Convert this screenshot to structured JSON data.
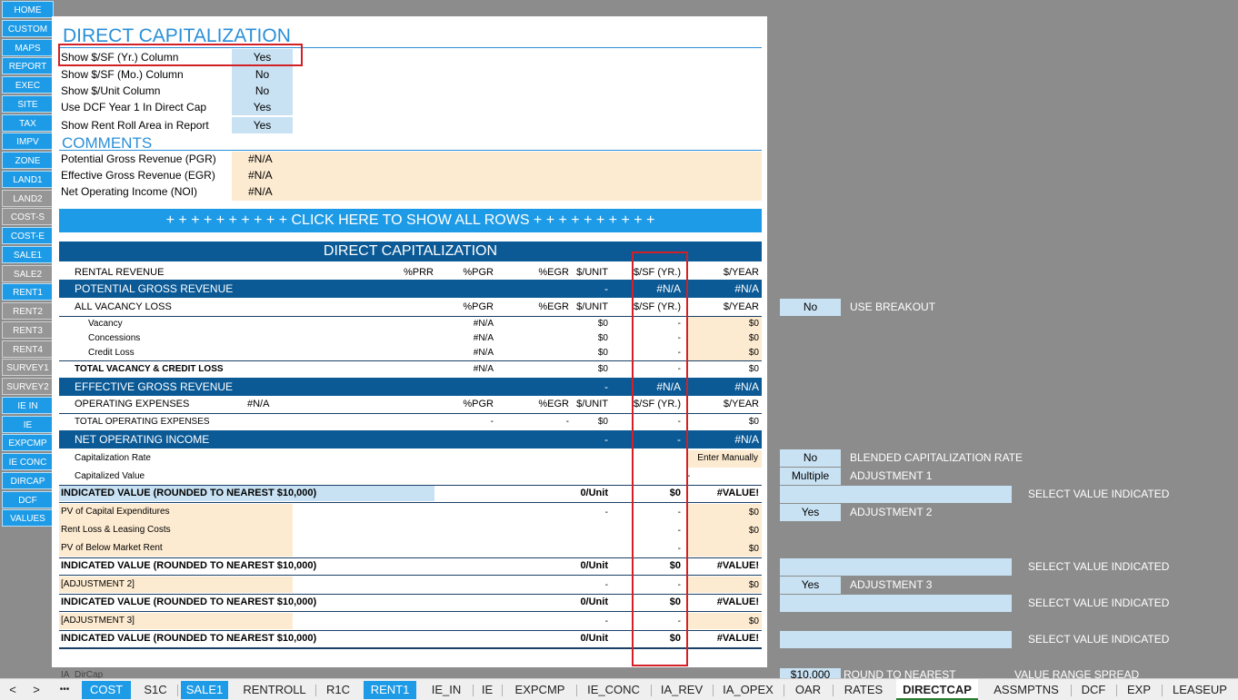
{
  "nav": [
    "HOME",
    "CUSTOM",
    "MAPS",
    "REPORT",
    "EXEC",
    "SITE",
    "TAX",
    "IMPV",
    "ZONE",
    "LAND1",
    "LAND2",
    "COST-S",
    "COST-E",
    "SALE1",
    "SALE2",
    "RENT1",
    "RENT2",
    "RENT3",
    "RENT4",
    "SURVEY1",
    "SURVEY2",
    "IE IN",
    "IE",
    "EXPCMP",
    "IE CONC",
    "DIRCAP",
    "DCF",
    "VALUES"
  ],
  "title": "DIRECT CAPITALIZATION",
  "settings": [
    {
      "label": "Show $/SF (Yr.) Column",
      "value": "Yes"
    },
    {
      "label": "Show $/SF (Mo.) Column",
      "value": "No"
    },
    {
      "label": "Show $/Unit Column",
      "value": "No"
    },
    {
      "label": "Use DCF Year 1 In Direct Cap",
      "value": "Yes"
    },
    {
      "label": "Show Rent Roll Area in Report",
      "value": "Yes"
    }
  ],
  "comments_title": "COMMENTS",
  "comments": [
    {
      "label": "Potential Gross Revenue (PGR)",
      "value": "#N/A"
    },
    {
      "label": "Effective Gross Revenue (EGR)",
      "value": "#N/A"
    },
    {
      "label": "Net Operating Income (NOI)",
      "value": "#N/A"
    }
  ],
  "show_all": "+ + + + + + + + + + CLICK HERE TO SHOW ALL ROWS + + + + + + + + + +",
  "table_title": "DIRECT CAPITALIZATION",
  "h_rental": {
    "label": "RENTAL REVENUE",
    "prr": "%PRR",
    "pgr": "%PGR",
    "egr": "%EGR",
    "unit": "$/UNIT",
    "sf": "$/SF (YR.)",
    "year": "$/YEAR"
  },
  "pgr_row": {
    "label": "POTENTIAL GROSS REVENUE",
    "unit": "-",
    "sf": "#N/A",
    "year": "#N/A"
  },
  "h_vacancy": {
    "label": "ALL VACANCY LOSS",
    "pgr": "%PGR",
    "egr": "%EGR",
    "unit": "$/UNIT",
    "sf": "$/SF (YR.)",
    "year": "$/YEAR"
  },
  "vac_rows": [
    {
      "label": "Vacancy",
      "pgr": "#N/A",
      "unit": "$0",
      "sf": "-",
      "year": "$0"
    },
    {
      "label": "Concessions",
      "pgr": "#N/A",
      "unit": "$0",
      "sf": "-",
      "year": "$0"
    },
    {
      "label": "Credit Loss",
      "pgr": "#N/A",
      "unit": "$0",
      "sf": "-",
      "year": "$0"
    }
  ],
  "total_vac": {
    "label": "TOTAL VACANCY & CREDIT LOSS",
    "pgr": "#N/A",
    "unit": "$0",
    "sf": "-",
    "year": "$0"
  },
  "egr_row": {
    "label": "EFFECTIVE GROSS REVENUE",
    "unit": "-",
    "sf": "#N/A",
    "year": "#N/A"
  },
  "h_opex": {
    "label": "OPERATING EXPENSES",
    "na": "#N/A",
    "pgr": "%PGR",
    "egr": "%EGR",
    "unit": "$/UNIT",
    "sf": "$/SF (YR.)",
    "year": "$/YEAR"
  },
  "total_opex": {
    "label": "TOTAL OPERATING EXPENSES",
    "pgr": "-",
    "egr": "-",
    "unit": "$0",
    "sf": "-",
    "year": "$0"
  },
  "noi_row": {
    "label": "NET OPERATING INCOME",
    "unit": "-",
    "sf": "-",
    "year": "#N/A"
  },
  "cap_rate": {
    "label": "Capitalization Rate",
    "year": "Enter Manually"
  },
  "cap_value": {
    "label": "Capitalized Value",
    "year": "-"
  },
  "ind1": {
    "label": "INDICATED VALUE (ROUNDED TO NEAREST $10,000)",
    "unit": "0/Unit",
    "sf": "$0",
    "year": "#VALUE!"
  },
  "adj_rows": [
    {
      "label": "PV of Capital Expenditures",
      "unit": "-",
      "sf": "-",
      "year": "$0"
    },
    {
      "label": "Rent Loss & Leasing Costs",
      "unit": "",
      "sf": "-",
      "year": "$0"
    },
    {
      "label": "PV of Below Market Rent",
      "unit": "",
      "sf": "-",
      "year": "$0"
    }
  ],
  "ind2": {
    "label": "INDICATED VALUE (ROUNDED TO NEAREST $10,000)",
    "unit": "0/Unit",
    "sf": "$0",
    "year": "#VALUE!"
  },
  "adj2": {
    "label": "[ADJUSTMENT 2]",
    "unit": "-",
    "sf": "-",
    "year": "$0"
  },
  "ind3": {
    "label": "INDICATED VALUE (ROUNDED TO NEAREST $10,000)",
    "unit": "0/Unit",
    "sf": "$0",
    "year": "#VALUE!"
  },
  "adj3": {
    "label": "[ADJUSTMENT 3]",
    "unit": "-",
    "sf": "-",
    "year": "$0"
  },
  "ind4": {
    "label": "INDICATED VALUE (ROUNDED TO NEAREST $10,000)",
    "unit": "0/Unit",
    "sf": "$0",
    "year": "#VALUE!"
  },
  "side": {
    "use_breakout": {
      "value": "No",
      "label": "USE BREAKOUT"
    },
    "blended": {
      "value": "No",
      "label": "BLENDED CAPITALIZATION RATE"
    },
    "adj1": {
      "value": "Multiple",
      "label": "ADJUSTMENT 1"
    },
    "select1": "SELECT VALUE INDICATED",
    "adj2": {
      "value": "Yes",
      "label": "ADJUSTMENT 2"
    },
    "select2": "SELECT VALUE INDICATED",
    "adj3": {
      "value": "Yes",
      "label": "ADJUSTMENT 3"
    },
    "select3": "SELECT VALUE INDICATED",
    "select4": "SELECT VALUE INDICATED",
    "round_value": "$10,000",
    "round_label": "ROUND TO NEAREST",
    "spread_label": "VALUE RANGE SPREAD"
  },
  "bottom_cut": "IA_DirCap",
  "tabs": [
    "COST",
    "S1C",
    "SALE1",
    "RENTROLL",
    "R1C",
    "RENT1",
    "IE_IN",
    "IE",
    "EXPCMP",
    "IE_CONC",
    "IA_REV",
    "IA_OPEX",
    "OAR",
    "RATES",
    "DIRECTCAP",
    "ASSMPTNS",
    "DCF",
    "EXP",
    "LEASEUP"
  ],
  "tab_nav": {
    "prev": "<",
    "next": ">",
    "more": "•••"
  },
  "colors": {
    "accent": "#1e9be6",
    "navy": "#0b5a96",
    "cream": "#fdebd1",
    "input": "#c9e2f3",
    "highlight": "#d32026"
  }
}
